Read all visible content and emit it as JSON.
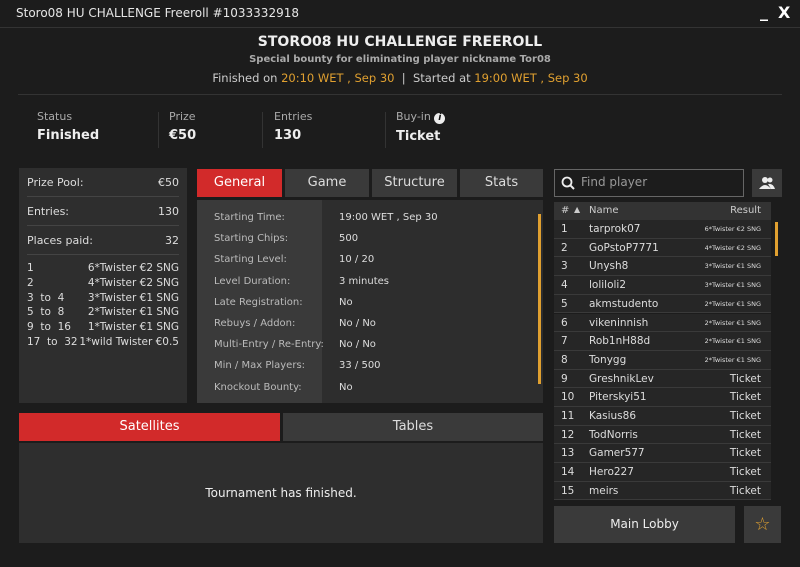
{
  "window": {
    "title": "Storo08 HU CHALLENGE Freeroll #1033332918",
    "minimize": "_",
    "close": "X"
  },
  "header": {
    "title": "STORO08 HU CHALLENGE FREEROLL",
    "subtitle": "Special bounty for eliminating player nickname Tor08",
    "finished_label": "Finished on",
    "finished_time": "20:10 WET , Sep 30",
    "separator": "|",
    "started_label": "Started at",
    "started_time": "19:00 WET , Sep 30"
  },
  "stats": [
    {
      "label": "Status",
      "value": "Finished"
    },
    {
      "label": "Prize",
      "value": "€50"
    },
    {
      "label": "Entries",
      "value": "130"
    },
    {
      "label": "Buy-in",
      "value": "Ticket"
    }
  ],
  "summary": {
    "rows": [
      {
        "label": "Prize Pool:",
        "value": "€50"
      },
      {
        "label": "Entries:",
        "value": "130"
      },
      {
        "label": "Places paid:",
        "value": "32"
      }
    ],
    "prizes": [
      {
        "place": "1",
        "prize": "6*Twister €2 SNG"
      },
      {
        "place": "2",
        "prize": "4*Twister €2 SNG"
      },
      {
        "place": "3  to  4",
        "prize": "3*Twister €1 SNG"
      },
      {
        "place": "5  to  8",
        "prize": "2*Twister €1 SNG"
      },
      {
        "place": "9  to  16",
        "prize": "1*Twister €1 SNG"
      },
      {
        "place": "17  to  32",
        "prize": "1*wild Twister €0.5"
      }
    ]
  },
  "tabs": [
    {
      "label": "General",
      "active": true
    },
    {
      "label": "Game"
    },
    {
      "label": "Structure"
    },
    {
      "label": "Stats"
    }
  ],
  "general": [
    {
      "label": "Starting Time:",
      "value": "19:00 WET , Sep 30"
    },
    {
      "label": "Starting Chips:",
      "value": "500"
    },
    {
      "label": "Starting Level:",
      "value": "10 / 20"
    },
    {
      "label": "Level Duration:",
      "value": "3 minutes"
    },
    {
      "label": "Late Registration:",
      "value": "No"
    },
    {
      "label": "Rebuys / Addon:",
      "value": "No / No"
    },
    {
      "label": "Multi-Entry / Re-Entry:",
      "value": "No / No"
    },
    {
      "label": "Min / Max Players:",
      "value": "33 / 500"
    },
    {
      "label": "Knockout Bounty:",
      "value": "No"
    }
  ],
  "bottom_tabs": [
    {
      "label": "Satellites",
      "active": true
    },
    {
      "label": "Tables"
    }
  ],
  "bottom_message": "Tournament has finished.",
  "players": {
    "search_placeholder": "Find player",
    "headers": {
      "num": "#",
      "sort": "▲",
      "name": "Name",
      "result": "Result"
    },
    "rows": [
      {
        "n": "1",
        "name": "tarprok07",
        "result": "6*Twister €2 SNG"
      },
      {
        "n": "2",
        "name": "GoPstoP7771",
        "result": "4*Twister €2 SNG"
      },
      {
        "n": "3",
        "name": "Unysh8",
        "result": "3*Twister €1 SNG"
      },
      {
        "n": "4",
        "name": "lolilolі2",
        "result": "3*Twister €1 SNG"
      },
      {
        "n": "5",
        "name": "akmstudento",
        "result": "2*Twister €1 SNG"
      },
      {
        "n": "6",
        "name": "vikeninnish",
        "result": "2*Twister €1 SNG"
      },
      {
        "n": "7",
        "name": "Rob1nH88d",
        "result": "2*Twister €1 SNG"
      },
      {
        "n": "8",
        "name": "Tonygg",
        "result": "2*Twister €1 SNG"
      },
      {
        "n": "9",
        "name": "GreshnikLev",
        "result": "Ticket"
      },
      {
        "n": "10",
        "name": "Piterskyi51",
        "result": "Ticket"
      },
      {
        "n": "11",
        "name": "Kasius86",
        "result": "Ticket"
      },
      {
        "n": "12",
        "name": "TodNorris",
        "result": "Ticket"
      },
      {
        "n": "13",
        "name": "Gamer577",
        "result": "Ticket"
      },
      {
        "n": "14",
        "name": "Hero227",
        "result": "Ticket"
      },
      {
        "n": "15",
        "name": "meirs",
        "result": "Ticket"
      }
    ]
  },
  "main_lobby": "Main Lobby",
  "colors": {
    "accent": "#d22a2a",
    "highlight": "#e0a030"
  }
}
